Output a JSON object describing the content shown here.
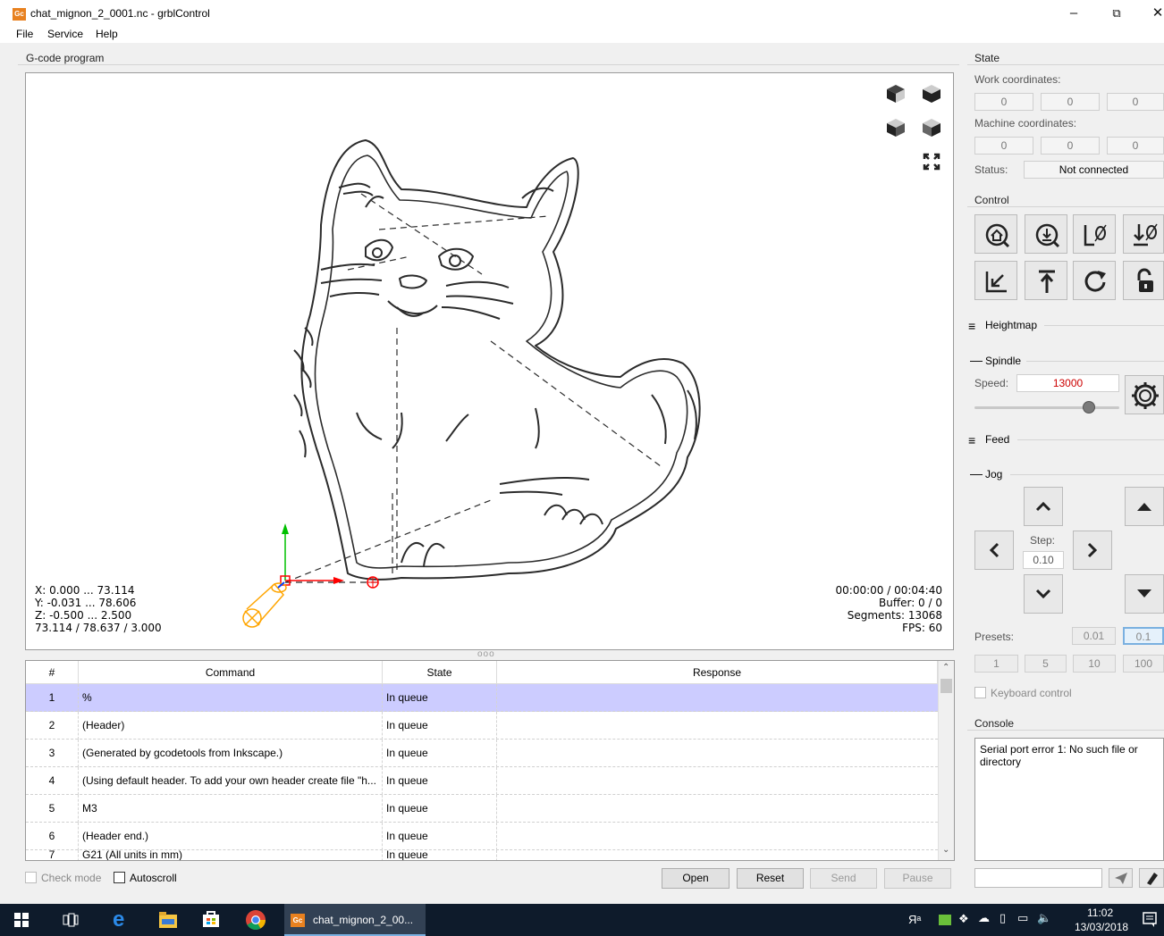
{
  "window": {
    "title": "chat_mignon_2_0001.nc - grblControl",
    "app_icon": "Gc"
  },
  "menu": [
    "File",
    "Service",
    "Help"
  ],
  "gcode_panel": {
    "title": "G-code program",
    "overlay_left": [
      "X: 0.000 ... 73.114",
      "Y: -0.031 ... 78.606",
      "Z: -0.500 ... 2.500",
      "73.114 / 78.637 / 3.000"
    ],
    "overlay_right": [
      "00:00:00 / 00:04:40",
      "Buffer: 0 / 0",
      "Segments: 13068",
      "FPS: 60"
    ],
    "splitter_handle": "ooo"
  },
  "table": {
    "columns": [
      "#",
      "Command",
      "State",
      "Response"
    ],
    "rows": [
      {
        "num": "1",
        "command": "%",
        "state": "In queue",
        "response": ""
      },
      {
        "num": "2",
        "command": "(Header)",
        "state": "In queue",
        "response": ""
      },
      {
        "num": "3",
        "command": "(Generated by gcodetools from Inkscape.)",
        "state": "In queue",
        "response": ""
      },
      {
        "num": "4",
        "command": "(Using default header. To add your own header create file \"h...",
        "state": "In queue",
        "response": ""
      },
      {
        "num": "5",
        "command": "M3",
        "state": "In queue",
        "response": ""
      },
      {
        "num": "6",
        "command": "(Header end.)",
        "state": "In queue",
        "response": ""
      },
      {
        "num": "7",
        "command": "G21 (All units in mm)",
        "state": "In queue",
        "response": ""
      }
    ]
  },
  "bottom_bar": {
    "check_mode": "Check mode",
    "autoscroll": "Autoscroll",
    "open": "Open",
    "reset": "Reset",
    "send": "Send",
    "pause": "Pause"
  },
  "state_panel": {
    "title": "State",
    "work_label": "Work coordinates:",
    "work": [
      "0",
      "0",
      "0"
    ],
    "machine_label": "Machine coordinates:",
    "machine": [
      "0",
      "0",
      "0"
    ],
    "status_label": "Status:",
    "status": "Not connected"
  },
  "control_panel": {
    "title": "Control"
  },
  "heightmap": {
    "title": "Heightmap"
  },
  "spindle": {
    "title": "Spindle",
    "speed_label": "Speed:",
    "speed": "13000",
    "slider_fraction": 0.79
  },
  "feed": {
    "title": "Feed"
  },
  "jog": {
    "title": "Jog",
    "step_label": "Step:",
    "step": "0.10",
    "presets_label": "Presets:",
    "presets_row1": [
      "0.01",
      "0.1"
    ],
    "presets_row2": [
      "1",
      "5",
      "10",
      "100"
    ],
    "keyboard_control": "Keyboard control"
  },
  "console": {
    "title": "Console",
    "text": "Serial port error 1: No such file or directory"
  },
  "taskbar": {
    "app_label": "chat_mignon_2_00...",
    "time": "11:02",
    "date": "13/03/2018"
  },
  "colors": {
    "selected_row": "#ccccff",
    "speed_text": "#cc0000",
    "axis_x": "#ff0000",
    "axis_y": "#00c000",
    "tool": "#ffa500"
  }
}
